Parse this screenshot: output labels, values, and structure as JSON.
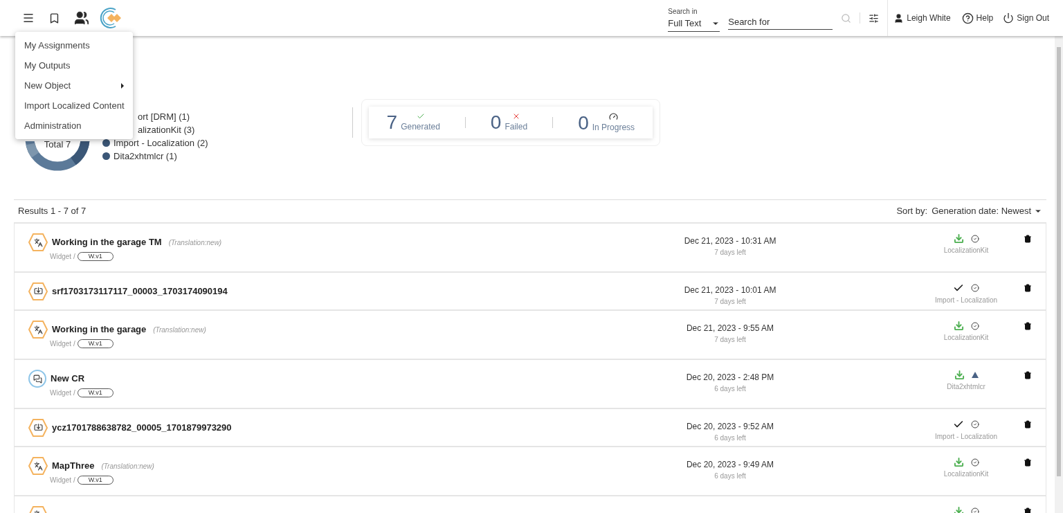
{
  "header": {
    "search_in": {
      "label": "Search in",
      "value": "Full Text"
    },
    "search": {
      "placeholder": "Search for"
    },
    "user": "Leigh White",
    "help": "Help",
    "sign_out": "Sign Out"
  },
  "menu": {
    "items": [
      {
        "label": "My Assignments",
        "submenu": false
      },
      {
        "label": "My Outputs",
        "submenu": false
      },
      {
        "label": "New Object",
        "submenu": true
      },
      {
        "label": "Import Localized Content",
        "submenu": false
      },
      {
        "label": "Administration",
        "submenu": false
      }
    ]
  },
  "summary": {
    "total": "Total 7",
    "legend": [
      {
        "label": "ort [DRM] (1)",
        "kind": "clipped"
      },
      {
        "label": "alizationKit (3)",
        "kind": "clipped"
      },
      {
        "label": "Import - Localization (2)",
        "kind": "full"
      },
      {
        "label": "Dita2xhtmlcr (1)",
        "kind": "full"
      }
    ],
    "stats": [
      {
        "value": "7",
        "label": "Generated",
        "kind": "success"
      },
      {
        "value": "0",
        "label": "Failed",
        "kind": "failed"
      },
      {
        "value": "0",
        "label": "In Progress",
        "kind": "progress"
      }
    ]
  },
  "results": {
    "count": "Results 1 - 7 of 7",
    "sort_label": "Sort by:",
    "sort_value": "Generation date: Newest"
  },
  "rows": [
    {
      "kind": "translation",
      "title": "Working in the garage TM",
      "note": "(Translation:new)",
      "path": "Widget /",
      "version": "W.v1",
      "date": "Dec 21, 2023 - 10:31 AM",
      "left": "7 days left",
      "downloadable": true,
      "warning": false,
      "type": "LocalizationKit"
    },
    {
      "kind": "import",
      "title": "srf1703173117117_00003_1703174090194",
      "date": "Dec 21, 2023 - 10:01 AM",
      "left": "7 days left",
      "downloadable": false,
      "warning": false,
      "type": "Import - Localization"
    },
    {
      "kind": "translation",
      "title": "Working in the garage",
      "note": "(Translation:new)",
      "path": "Widget /",
      "version": "W.v1",
      "date": "Dec 21, 2023 - 9:55 AM",
      "left": "7 days left",
      "downloadable": true,
      "warning": false,
      "type": "LocalizationKit"
    },
    {
      "kind": "review",
      "title": "New CR",
      "path": "Widget /",
      "version": "W.v1",
      "date": "Dec 20, 2023 - 2:48 PM",
      "left": "6 days left",
      "downloadable": true,
      "warning": true,
      "type": "Dita2xhtmlcr"
    },
    {
      "kind": "import",
      "title": "ycz1701788638782_00005_1701879973290",
      "date": "Dec 20, 2023 - 9:52 AM",
      "left": "6 days left",
      "downloadable": false,
      "warning": false,
      "type": "Import - Localization"
    },
    {
      "kind": "translation",
      "title": "MapThree",
      "note": "(Translation:new)",
      "path": "Widget /",
      "version": "W.v1",
      "date": "Dec 20, 2023 - 9:49 AM",
      "left": "6 days left",
      "downloadable": true,
      "warning": false,
      "type": "LocalizationKit"
    },
    {
      "kind": "translation",
      "downloadable": true,
      "warning": false
    }
  ]
}
